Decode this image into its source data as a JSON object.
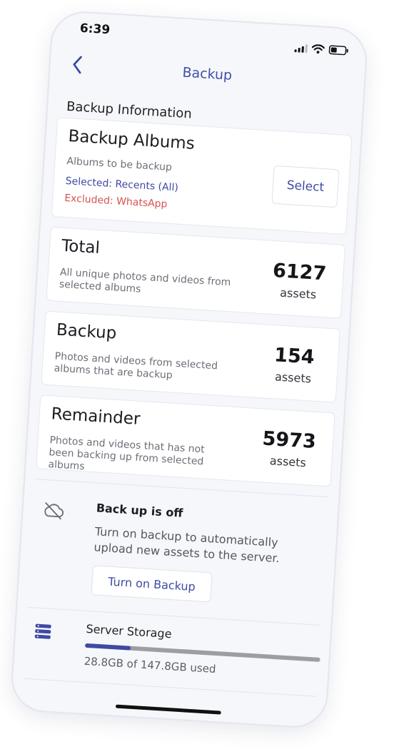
{
  "status_bar": {
    "time": "6:39"
  },
  "header": {
    "title": "Backup"
  },
  "section_title": "Backup Information",
  "albums": {
    "heading": "Backup Albums",
    "description": "Albums to be backup",
    "selected": "Selected: Recents (All)",
    "excluded": "Excluded: WhatsApp",
    "select_label": "Select"
  },
  "stats": {
    "total": {
      "heading": "Total",
      "description": "All unique photos and videos from selected albums",
      "value": "6127",
      "unit": "assets"
    },
    "backup": {
      "heading": "Backup",
      "description": "Photos and videos from selected albums that are backup",
      "value": "154",
      "unit": "assets"
    },
    "remainder": {
      "heading": "Remainder",
      "description": "Photos and videos that has not been backing up from selected albums",
      "value": "5973",
      "unit": "assets"
    }
  },
  "backup_status": {
    "title": "Back up is off",
    "description": "Turn on backup to automatically upload new assets to the server.",
    "button_label": "Turn on Backup",
    "icon": "cloud-off-icon"
  },
  "storage": {
    "title": "Server Storage",
    "used_text": "28.8GB of 147.8GB used",
    "used_fraction": 0.195,
    "icon": "database-icon"
  },
  "colors": {
    "accent": "#3f4aa3",
    "excluded": "#d4544e",
    "background": "#f6f7fb"
  }
}
